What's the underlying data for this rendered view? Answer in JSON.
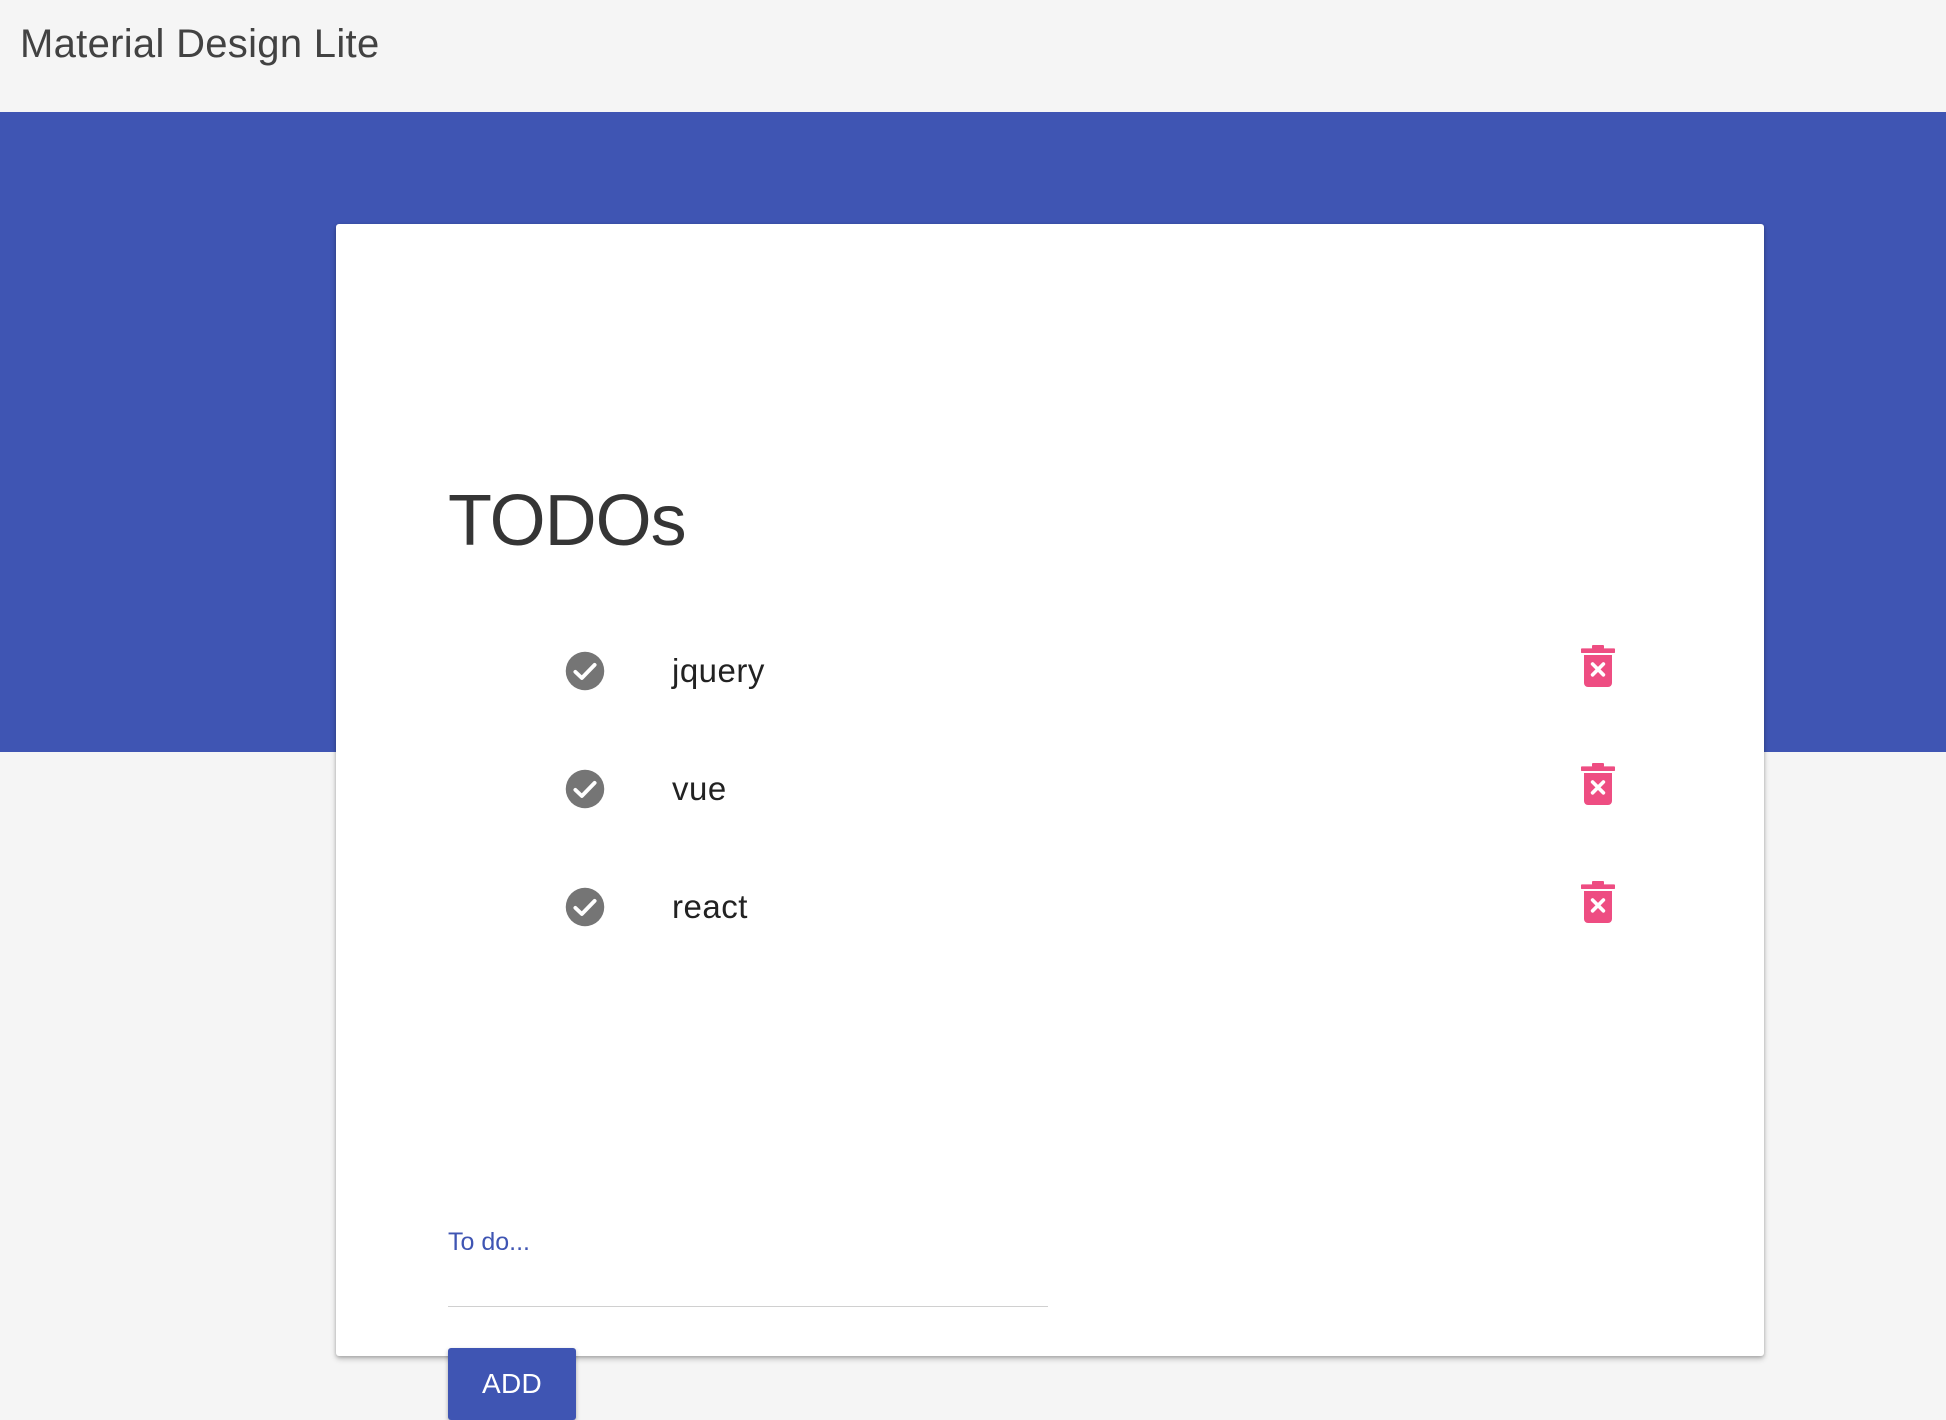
{
  "header": {
    "title": "Material Design Lite"
  },
  "card": {
    "title": "TODOs",
    "todos": [
      {
        "label": "jquery",
        "done_icon": "check-circle-icon",
        "delete_icon": "delete-forever-icon"
      },
      {
        "label": "vue",
        "done_icon": "check-circle-icon",
        "delete_icon": "delete-forever-icon"
      },
      {
        "label": "react",
        "done_icon": "check-circle-icon",
        "delete_icon": "delete-forever-icon"
      }
    ],
    "input": {
      "label": "To do...",
      "value": ""
    },
    "add_button_label": "ADD"
  },
  "colors": {
    "primary": "#3f55b3",
    "accent": "#ee4d82",
    "check_icon": "#757575",
    "background": "#f5f5f5"
  }
}
